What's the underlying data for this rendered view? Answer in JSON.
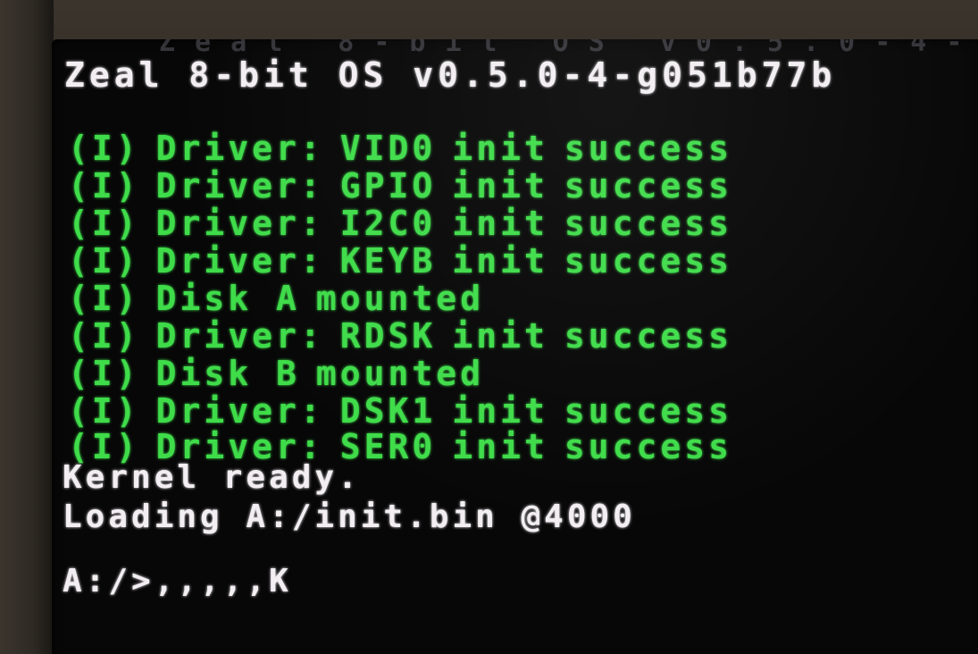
{
  "terminal": {
    "banner": "Zeal 8-bit OS v0.5.0-4-g051b77b",
    "log": [
      {
        "prefix": "(I)",
        "label": "Driver:",
        "name": "VID0",
        "action": "init",
        "status": "success"
      },
      {
        "prefix": "(I)",
        "label": "Driver:",
        "name": "GPIO",
        "action": "init",
        "status": "success"
      },
      {
        "prefix": "(I)",
        "label": "Driver:",
        "name": "I2C0",
        "action": "init",
        "status": "success"
      },
      {
        "prefix": "(I)",
        "label": "Driver:",
        "name": "KEYB",
        "action": "init",
        "status": "success"
      },
      {
        "prefix": "(I)",
        "label": "Disk A",
        "name": "mounted",
        "action": "",
        "status": ""
      },
      {
        "prefix": "(I)",
        "label": "Driver:",
        "name": "RDSK",
        "action": "init",
        "status": "success"
      },
      {
        "prefix": "(I)",
        "label": "Disk B",
        "name": "mounted",
        "action": "",
        "status": ""
      },
      {
        "prefix": "(I)",
        "label": "Driver:",
        "name": "DSK1",
        "action": "init",
        "status": "success"
      },
      {
        "prefix": "(I)",
        "label": "Driver:",
        "name": "SER0",
        "action": "init",
        "status": "success"
      }
    ],
    "kernel_ready": "Kernel ready.",
    "loading": "Loading A:/init.bin @4000",
    "prompt": "A:/>",
    "input": ",,,,,K"
  },
  "colors": {
    "text_white": "#f2eef2",
    "text_green": "#3fdc4a",
    "screen_bg": "#070707"
  }
}
